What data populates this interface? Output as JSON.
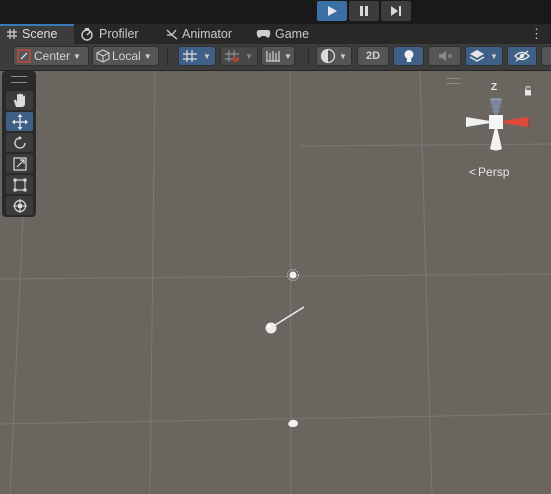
{
  "tabs": [
    {
      "label": "Scene",
      "icon": "grid-icon"
    },
    {
      "label": "Profiler",
      "icon": "profiler-icon"
    },
    {
      "label": "Animator",
      "icon": "animator-icon"
    },
    {
      "label": "Game",
      "icon": "gamepad-icon"
    }
  ],
  "toolbar": {
    "pivot_label": "Center",
    "space_label": "Local",
    "mode_2d_label": "2D"
  },
  "gizmo": {
    "z_label": "Z",
    "persp_label": "Persp"
  },
  "colors": {
    "accent": "#3a79bb",
    "active_button": "#3e5f86",
    "scene_background": "#6b6560",
    "x_axis": "#e0483c"
  }
}
